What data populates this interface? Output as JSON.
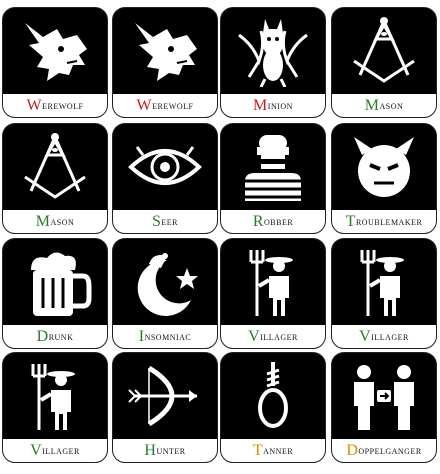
{
  "cards": [
    {
      "name": "Werewolf",
      "team": "evil",
      "icon": "wolf-head-icon"
    },
    {
      "name": "Werewolf",
      "team": "evil",
      "icon": "wolf-head-icon"
    },
    {
      "name": "Minion",
      "team": "evil",
      "icon": "demon-icon"
    },
    {
      "name": "Mason",
      "team": "good",
      "icon": "compass-square-icon"
    },
    {
      "name": "Mason",
      "team": "good",
      "icon": "compass-square-icon"
    },
    {
      "name": "Seer",
      "team": "good",
      "icon": "eye-icon"
    },
    {
      "name": "Robber",
      "team": "good",
      "icon": "robber-icon"
    },
    {
      "name": "Troublemaker",
      "team": "good",
      "icon": "devil-face-icon"
    },
    {
      "name": "Drunk",
      "team": "good",
      "icon": "beer-mug-icon"
    },
    {
      "name": "Insomniac",
      "team": "good",
      "icon": "moon-star-icon"
    },
    {
      "name": "Villager",
      "team": "good",
      "icon": "pitchfork-villager-icon"
    },
    {
      "name": "Villager",
      "team": "good",
      "icon": "pitchfork-villager-icon"
    },
    {
      "name": "Villager",
      "team": "good",
      "icon": "pitchfork-villager-icon"
    },
    {
      "name": "Hunter",
      "team": "good",
      "icon": "bow-arrow-icon"
    },
    {
      "name": "Tanner",
      "team": "neutral",
      "icon": "noose-icon"
    },
    {
      "name": "Doppelganger",
      "team": "neutral",
      "icon": "swap-people-icon"
    }
  ],
  "colors": {
    "evil": "#c02020",
    "good": "#2a7a2a",
    "neutral": "#e08a00"
  }
}
